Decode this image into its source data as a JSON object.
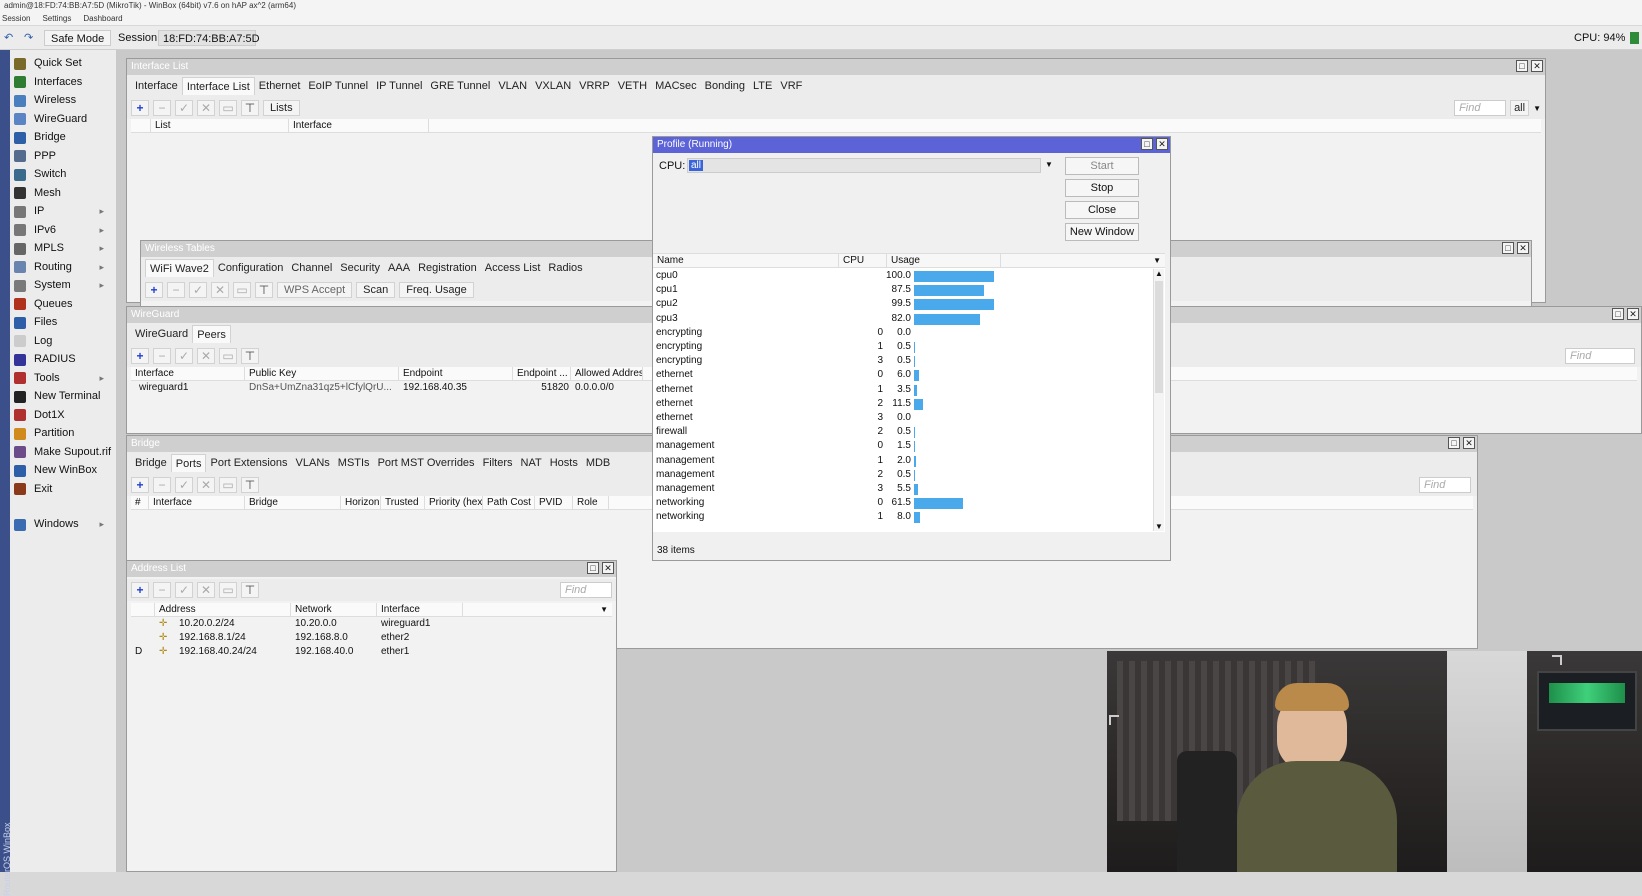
{
  "app": {
    "title": "admin@18:FD:74:BB:A7:5D (MikroTik) - WinBox (64bit) v7.6 on hAP ax^2 (arm64)",
    "menu": [
      "Session",
      "Settings",
      "Dashboard"
    ],
    "safe_mode": "Safe Mode",
    "session_label": "Session:",
    "session_value": "18:FD:74:BB:A7:5D",
    "cpu_label": "CPU: 94%",
    "side_brand": "RouterOS WinBox"
  },
  "sidebar": {
    "items": [
      {
        "label": "Quick Set",
        "color": "#7a6a2a"
      },
      {
        "label": "Interfaces",
        "color": "#2e7d32"
      },
      {
        "label": "Wireless",
        "color": "#4a7fbf"
      },
      {
        "label": "WireGuard",
        "color": "#5b84c4"
      },
      {
        "label": "Bridge",
        "color": "#2d5fa8"
      },
      {
        "label": "PPP",
        "color": "#556b8d"
      },
      {
        "label": "Switch",
        "color": "#3b6b8c"
      },
      {
        "label": "Mesh",
        "color": "#333333"
      },
      {
        "label": "IP",
        "color": "#777777"
      },
      {
        "label": "IPv6",
        "color": "#777777"
      },
      {
        "label": "MPLS",
        "color": "#666666"
      },
      {
        "label": "Routing",
        "color": "#6a84b0"
      },
      {
        "label": "System",
        "color": "#7a7a7a"
      },
      {
        "label": "Queues",
        "color": "#b0321c"
      },
      {
        "label": "Files",
        "color": "#2d5fa8"
      },
      {
        "label": "Log",
        "color": "#cccccc"
      },
      {
        "label": "RADIUS",
        "color": "#333399"
      },
      {
        "label": "Tools",
        "color": "#b03030"
      },
      {
        "label": "New Terminal",
        "color": "#222222"
      },
      {
        "label": "Dot1X",
        "color": "#b03030"
      },
      {
        "label": "Partition",
        "color": "#d08a1e"
      },
      {
        "label": "Make Supout.rif",
        "color": "#6b4b8a"
      },
      {
        "label": "New WinBox",
        "color": "#2d5fa8"
      },
      {
        "label": "Exit",
        "color": "#8a3a1a"
      },
      {
        "label": "Windows",
        "color": "#3b6bb0"
      }
    ]
  },
  "interface_list": {
    "title": "Interface List",
    "tabs": [
      "Interface",
      "Interface List",
      "Ethernet",
      "EoIP Tunnel",
      "IP Tunnel",
      "GRE Tunnel",
      "VLAN",
      "VXLAN",
      "VRRP",
      "VETH",
      "MACsec",
      "Bonding",
      "LTE",
      "VRF"
    ],
    "lists_button": "Lists",
    "find_placeholder": "Find",
    "filter_all": "all",
    "columns": [
      "List",
      "Interface"
    ]
  },
  "wireless_tables": {
    "title": "Wireless Tables",
    "tabs": [
      "WiFi Wave2",
      "Configuration",
      "Channel",
      "Security",
      "AAA",
      "Registration",
      "Access List",
      "Radios"
    ],
    "buttons": [
      "WPS Accept",
      "Scan",
      "Freq. Usage"
    ]
  },
  "wireguard": {
    "title": "WireGuard",
    "tabs": [
      "WireGuard",
      "Peers"
    ],
    "find_placeholder": "Find",
    "columns": [
      "Interface",
      "Public Key",
      "Endpoint",
      "Endpoint ...",
      "Allowed Addres..."
    ],
    "rows": [
      [
        "wireguard1",
        "DnSa+UmZna31qz5+lCfylQrU...",
        "192.168.40.35",
        "51820",
        "0.0.0.0/0"
      ]
    ]
  },
  "bridge": {
    "title": "Bridge",
    "tabs": [
      "Bridge",
      "Ports",
      "Port Extensions",
      "VLANs",
      "MSTIs",
      "Port MST Overrides",
      "Filters",
      "NAT",
      "Hosts",
      "MDB"
    ],
    "find_placeholder": "Find",
    "columns": [
      "#",
      "Interface",
      "Bridge",
      "Horizon",
      "Trusted",
      "Priority (hex)",
      "Path Cost",
      "PVID",
      "Role"
    ]
  },
  "address_list": {
    "title": "Address List",
    "find_placeholder": "Find",
    "columns": [
      "Address",
      "Network",
      "Interface"
    ],
    "rows": [
      {
        "flag": "",
        "address": "10.20.0.2/24",
        "network": "10.20.0.0",
        "interface": "wireguard1"
      },
      {
        "flag": "",
        "address": "192.168.8.1/24",
        "network": "192.168.8.0",
        "interface": "ether2"
      },
      {
        "flag": "D",
        "address": "192.168.40.24/24",
        "network": "192.168.40.0",
        "interface": "ether1"
      }
    ]
  },
  "profile": {
    "title": "Profile (Running)",
    "cpu_label": "CPU:",
    "cpu_value": "all",
    "buttons": [
      "Start",
      "Stop",
      "Close",
      "New Window"
    ],
    "columns": [
      "Name",
      "CPU",
      "Usage"
    ],
    "rows": [
      {
        "name": "cpu0",
        "cpu": "",
        "usage": "100.0"
      },
      {
        "name": "cpu1",
        "cpu": "",
        "usage": "87.5"
      },
      {
        "name": "cpu2",
        "cpu": "",
        "usage": "99.5"
      },
      {
        "name": "cpu3",
        "cpu": "",
        "usage": "82.0"
      },
      {
        "name": "encrypting",
        "cpu": "0",
        "usage": "0.0"
      },
      {
        "name": "encrypting",
        "cpu": "1",
        "usage": "0.5"
      },
      {
        "name": "encrypting",
        "cpu": "3",
        "usage": "0.5"
      },
      {
        "name": "ethernet",
        "cpu": "0",
        "usage": "6.0"
      },
      {
        "name": "ethernet",
        "cpu": "1",
        "usage": "3.5"
      },
      {
        "name": "ethernet",
        "cpu": "2",
        "usage": "11.5"
      },
      {
        "name": "ethernet",
        "cpu": "3",
        "usage": "0.0"
      },
      {
        "name": "firewall",
        "cpu": "2",
        "usage": "0.5"
      },
      {
        "name": "management",
        "cpu": "0",
        "usage": "1.5"
      },
      {
        "name": "management",
        "cpu": "1",
        "usage": "2.0"
      },
      {
        "name": "management",
        "cpu": "2",
        "usage": "0.5"
      },
      {
        "name": "management",
        "cpu": "3",
        "usage": "5.5"
      },
      {
        "name": "networking",
        "cpu": "0",
        "usage": "61.5"
      },
      {
        "name": "networking",
        "cpu": "1",
        "usage": "8.0"
      }
    ],
    "item_count": "38 items"
  }
}
